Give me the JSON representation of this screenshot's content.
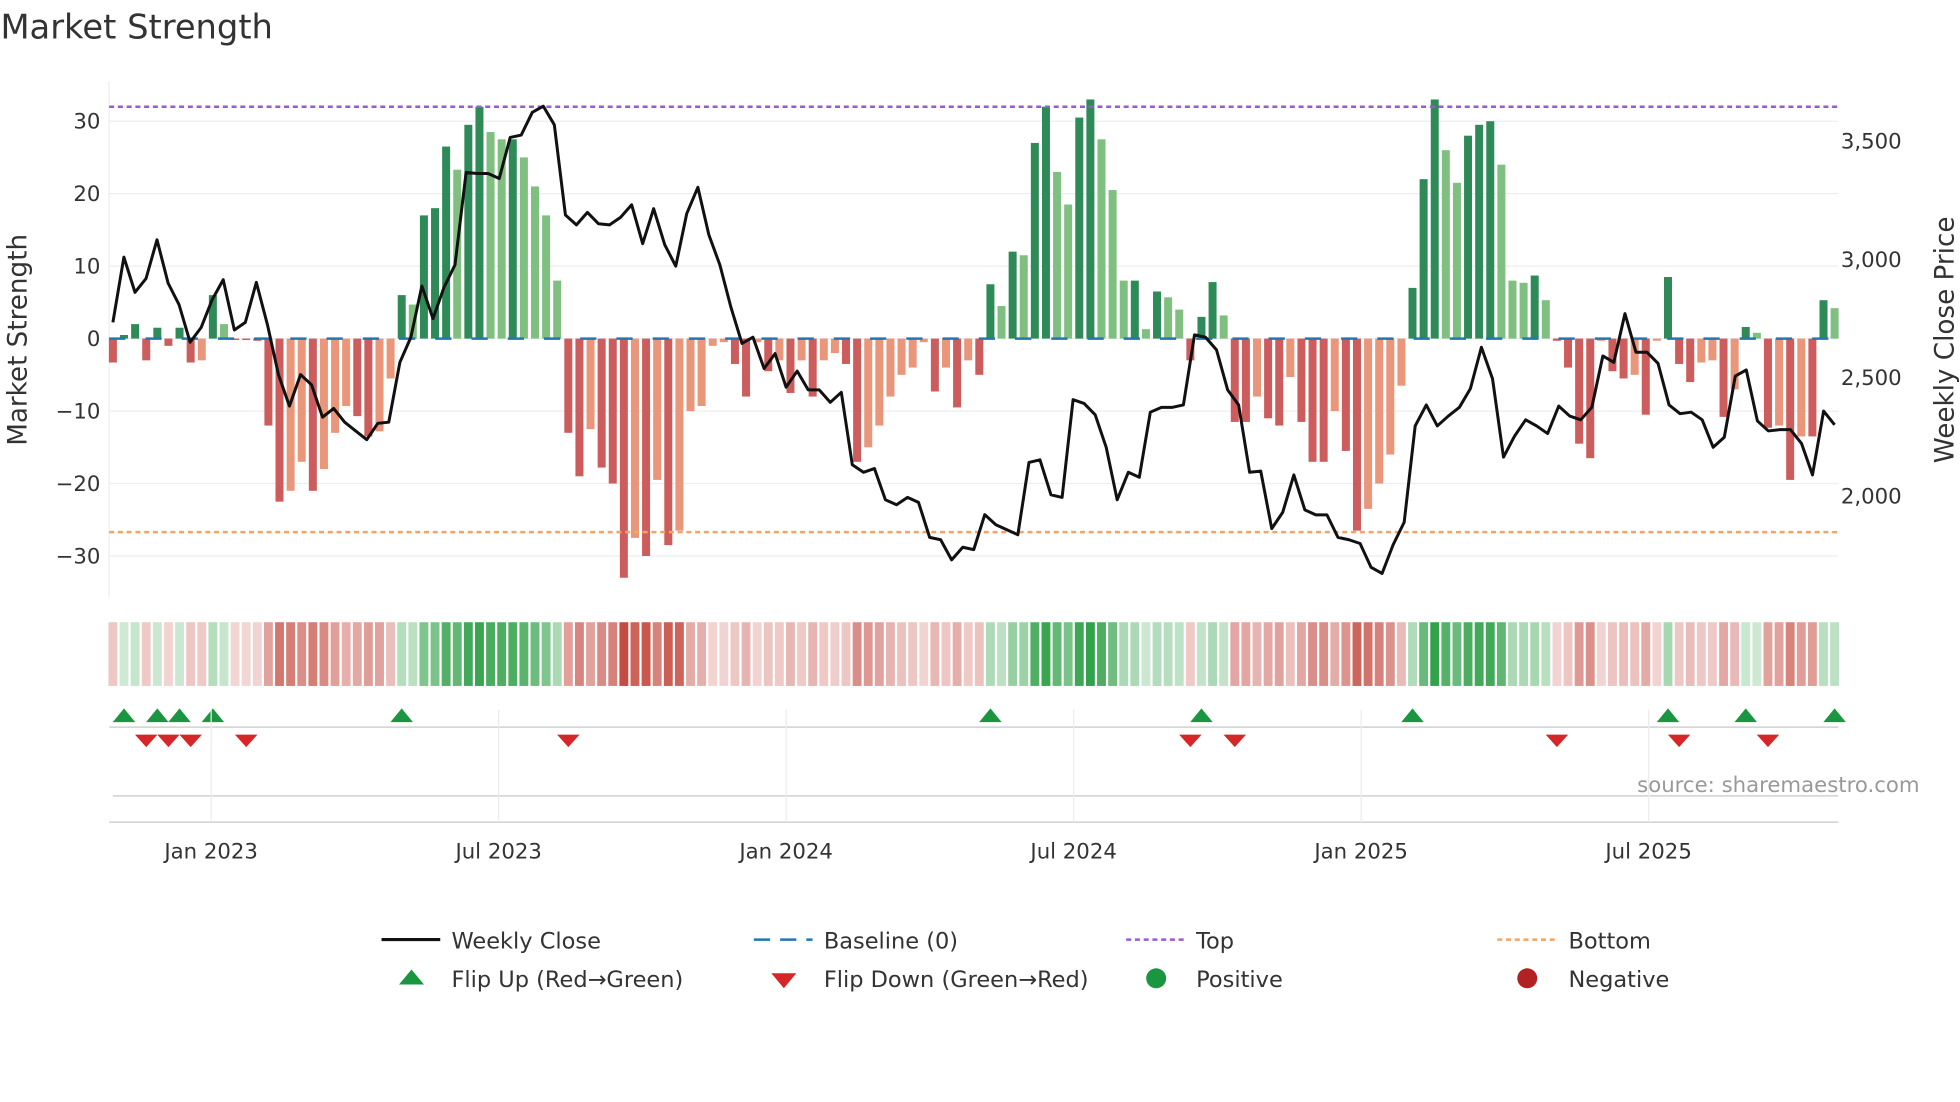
{
  "chart_data": {
    "type": "bar+line",
    "title": "Market Strength",
    "ylabel": "Market Strength",
    "y2label": "Weekly Close Price",
    "ylim": [
      -36,
      36
    ],
    "y2lim": [
      1610,
      3740
    ],
    "yticks": [
      "30",
      "20",
      "10",
      "0",
      "−10",
      "−20",
      "−30"
    ],
    "ytick_values": [
      30,
      20,
      10,
      0,
      -10,
      -20,
      -30
    ],
    "y2ticks": [
      "3,500",
      "3,000",
      "2,500",
      "2,000"
    ],
    "y2tick_values": [
      3500,
      3000,
      2500,
      2000
    ],
    "xticks": [
      "Jan 2023",
      "Jul 2023",
      "Jan 2024",
      "Jul 2024",
      "Jan 2025",
      "Jul 2025"
    ],
    "xtick_week_index": [
      9,
      35,
      61,
      87,
      113,
      139
    ],
    "top_level": 32,
    "bottom_level": -26.7,
    "baseline": 0,
    "strength": [
      -3.3,
      0.5,
      2,
      -3,
      1.5,
      -1,
      1.5,
      -3.3,
      -3,
      6,
      2,
      -0.2,
      -0.2,
      -0.3,
      -12,
      -22.5,
      -21,
      -17,
      -21,
      -18,
      -13,
      -9.3,
      -10.7,
      -13.5,
      -12.8,
      -5.5,
      6,
      4.7,
      17,
      18,
      26.5,
      23.3,
      29.5,
      32,
      28.5,
      27.5,
      27.5,
      25,
      21,
      17,
      8,
      -13,
      -19,
      -12.5,
      -17.8,
      -20,
      -33,
      -27.5,
      -30,
      -19.5,
      -28.5,
      -26.5,
      -10,
      -9.3,
      -1,
      -0.5,
      -3.5,
      -8,
      -0.5,
      -4.5,
      -3,
      -7.5,
      -3,
      -8,
      -3,
      -2,
      -3.5,
      -17,
      -15,
      -12,
      -8,
      -5,
      -4,
      -0.5,
      -7.3,
      -4,
      -9.5,
      -3,
      -5,
      7.5,
      4.5,
      12,
      11.5,
      27,
      32,
      23,
      18.5,
      30.5,
      33,
      27.5,
      20.5,
      8,
      8,
      1.3,
      6.5,
      5.7,
      4,
      -3,
      3,
      7.8,
      3.2,
      -11.5,
      -11.5,
      -8,
      -11,
      -12,
      -5.3,
      -11.5,
      -17,
      -17,
      -10,
      -15.5,
      -26.5,
      -23.5,
      -20,
      -16,
      -6.5,
      7,
      22,
      33,
      26,
      21.5,
      28,
      29.5,
      30,
      24,
      8,
      7.7,
      8.7,
      5.3,
      -0.3,
      -4,
      -14.5,
      -16.5,
      -0.3,
      -4.5,
      -5.5,
      -5,
      -10.5,
      -0.3,
      8.5,
      -3.5,
      -6,
      -3.3,
      -3,
      -10.8,
      -7,
      1.6,
      0.8,
      -12.3,
      -12,
      -19.5,
      -13.5,
      -13.5,
      5.3,
      4.2
    ],
    "weekly_close": [
      2734,
      3010,
      2861,
      2919,
      3083,
      2900,
      2808,
      2650,
      2713,
      2830,
      2914,
      2702,
      2734,
      2903,
      2724,
      2513,
      2380,
      2513,
      2470,
      2333,
      2370,
      2312,
      2275,
      2238,
      2307,
      2312,
      2565,
      2671,
      2888,
      2750,
      2882,
      2977,
      3368,
      3363,
      3363,
      3342,
      3516,
      3526,
      3622,
      3648,
      3569,
      3188,
      3146,
      3199,
      3151,
      3146,
      3178,
      3231,
      3067,
      3215,
      3062,
      2972,
      3194,
      3305,
      3104,
      2977,
      2797,
      2645,
      2671,
      2539,
      2602,
      2460,
      2528,
      2449,
      2449,
      2396,
      2438,
      2132,
      2100,
      2116,
      1984,
      1963,
      1994,
      1973,
      1825,
      1815,
      1730,
      1783,
      1773,
      1921,
      1878,
      1857,
      1836,
      2142,
      2153,
      2005,
      1994,
      2407,
      2391,
      2343,
      2206,
      1984,
      2100,
      2079,
      2354,
      2375,
      2375,
      2385,
      2681,
      2671,
      2618,
      2449,
      2385,
      2100,
      2105,
      1862,
      1931,
      2089,
      1941,
      1920,
      1920,
      1825,
      1815,
      1799,
      1698,
      1672,
      1794,
      1889,
      2296,
      2385,
      2296,
      2338,
      2375,
      2454,
      2629,
      2496,
      2164,
      2253,
      2322,
      2296,
      2264,
      2380,
      2338,
      2322,
      2375,
      2592,
      2565,
      2771,
      2608,
      2608,
      2560,
      2385,
      2348,
      2354,
      2322,
      2206,
      2248,
      2507,
      2533,
      2317,
      2275,
      2280,
      2280,
      2222,
      2089,
      2359,
      2301
    ],
    "flip_up_weeks": [
      1,
      4,
      6,
      9,
      26,
      79,
      98,
      117,
      140,
      147,
      155
    ],
    "flip_down_weeks": [
      3,
      5,
      7,
      12,
      41,
      97,
      101,
      130,
      141,
      149
    ],
    "legend": {
      "placement": "bottom",
      "weekly_close": "Weekly Close",
      "baseline": "Baseline (0)",
      "top": "Top",
      "bottom": "Bottom",
      "flip_up": "Flip Up (Red→Green)",
      "flip_down": "Flip Down (Green→Red)",
      "positive": "Positive",
      "negative": "Negative"
    },
    "source": "source: sharemaestro.com",
    "colors": {
      "pos_strong": "#2e8b57",
      "pos_weak": "#7fbf7f",
      "neg_strong": "#cd5c5c",
      "neg_weak": "#e9967a",
      "top": "#9b59d0",
      "bottom": "#f4a460",
      "baseline": "#1f77b4",
      "close": "#111111",
      "flip_up": "#1a9641",
      "flip_down": "#d62728",
      "positive": "#1a9641",
      "negative": "#b22222"
    }
  }
}
